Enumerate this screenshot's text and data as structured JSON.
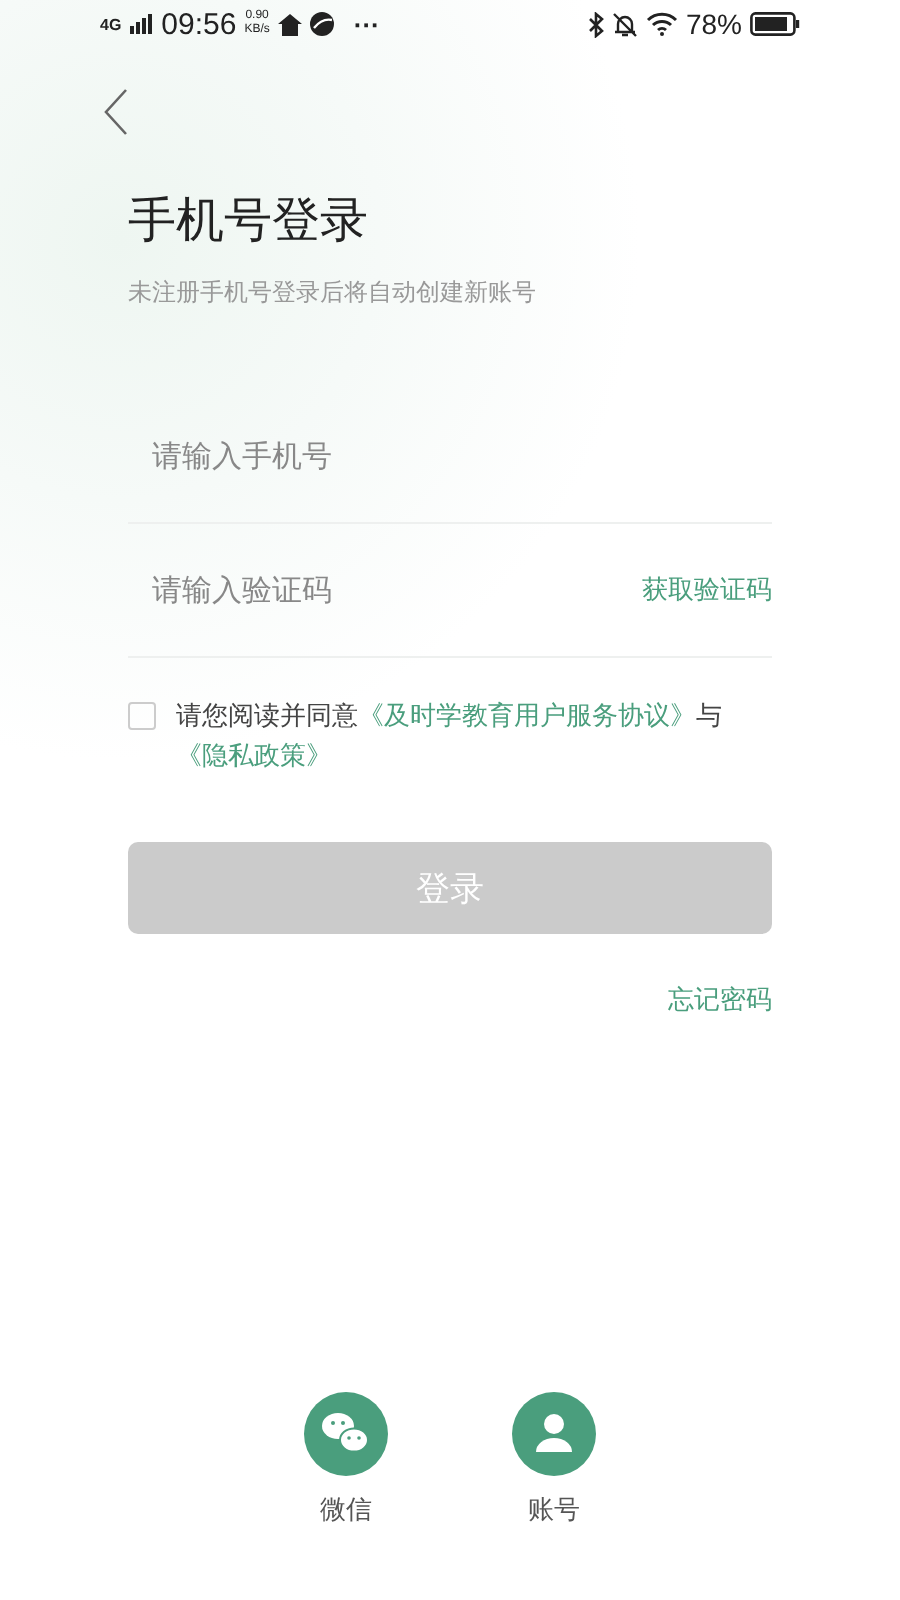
{
  "status_bar": {
    "network": "4G",
    "time": "09:56",
    "speed_value": "0.90",
    "speed_unit": "KB/s",
    "more": "···",
    "battery": "78%"
  },
  "title": "手机号登录",
  "subtitle": "未注册手机号登录后将自动创建新账号",
  "phone_field": {
    "placeholder": "请输入手机号"
  },
  "code_field": {
    "placeholder": "请输入验证码",
    "action": "获取验证码"
  },
  "agreement": {
    "checked": false,
    "text": "请您阅读并同意",
    "link_1": "《及时学教育用户服务协议》",
    "joiner": "与",
    "link_2": "《隐私政策》"
  },
  "login_button": {
    "label": "登录",
    "disabled": true
  },
  "forgot_password": "忘记密码",
  "social_logins": [
    {
      "kind": "wechat",
      "label": "微信"
    },
    {
      "kind": "account",
      "label": "账号"
    }
  ]
}
